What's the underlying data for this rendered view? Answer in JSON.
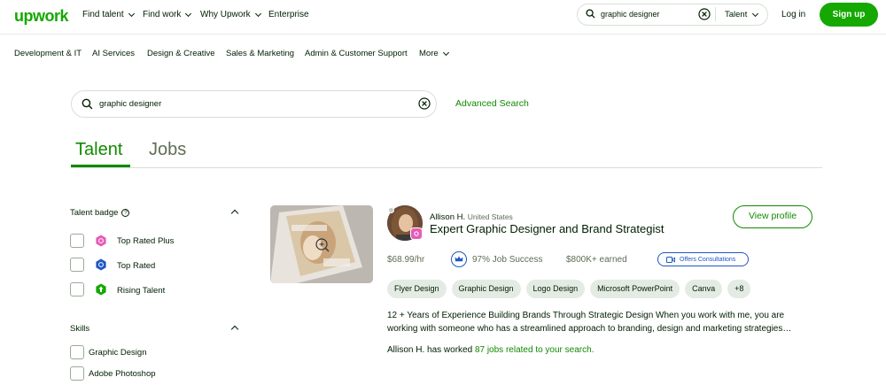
{
  "header": {
    "logo": "upwork",
    "nav": [
      "Find talent",
      "Find work",
      "Why Upwork",
      "Enterprise"
    ],
    "search_value": "graphic designer",
    "search_scope": "Talent",
    "login": "Log in",
    "signup": "Sign up"
  },
  "categories": [
    "Development & IT",
    "AI Services",
    "Design & Creative",
    "Sales & Marketing",
    "Admin & Customer Support",
    "More"
  ],
  "search": {
    "value": "graphic designer",
    "advanced": "Advanced Search"
  },
  "tabs": [
    "Talent",
    "Jobs"
  ],
  "filters": {
    "badge_title": "Talent badge",
    "badges": [
      "Top Rated Plus",
      "Top Rated",
      "Rising Talent"
    ],
    "skills_title": "Skills",
    "skills": [
      "Graphic Design",
      "Adobe Photoshop"
    ]
  },
  "result": {
    "name": "Allison H.",
    "location": "United States",
    "headline": "Expert Graphic Designer and Brand Strategist",
    "view_profile": "View profile",
    "rate": "$68.99/hr",
    "job_success": "97% Job Success",
    "earned": "$800K+ earned",
    "consultations": "Offers Consultations",
    "skills": [
      "Flyer Design",
      "Graphic Design",
      "Logo Design",
      "Microsoft PowerPoint",
      "Canva",
      "+8"
    ],
    "description": "12 + Years of Experience Building Brands Through Strategic Design When you work with me, you are working with someone who has a streamlined approach to branding, design and marketing strategies…",
    "worked_prefix": "Allison H. has worked",
    "worked_link": "87 jobs related to your search."
  },
  "colors": {
    "brand": "#14a800",
    "link": "#108a00",
    "top_rated_plus": "#e65bb6",
    "top_rated": "#1f57c3",
    "rising_talent": "#14a800"
  }
}
